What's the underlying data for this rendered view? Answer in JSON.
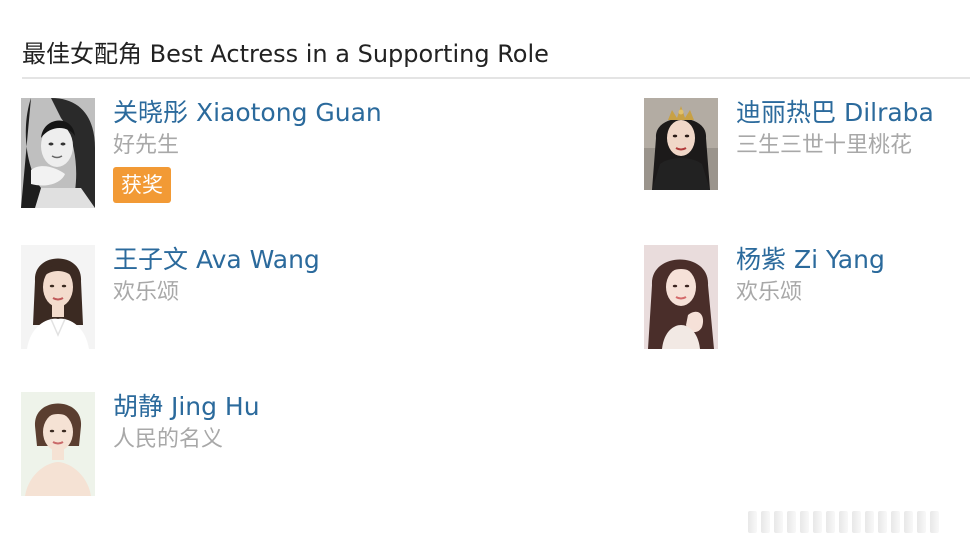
{
  "section": {
    "title": "最佳女配角 Best Actress in a Supporting Role"
  },
  "nominees": [
    {
      "name": "关晓彤 Xiaotong Guan",
      "film": "好先生",
      "badge": "获奖",
      "photo_icon": "portrait-photo-bw"
    },
    {
      "name": "迪丽热巴 Dilraba",
      "film": "三生三世十里桃花",
      "photo_icon": "portrait-photo-crown"
    },
    {
      "name": "王子文 Ava Wang",
      "film": "欢乐颂",
      "photo_icon": "portrait-photo"
    },
    {
      "name": "杨紫 Zi Yang",
      "film": "欢乐颂",
      "photo_icon": "portrait-photo"
    },
    {
      "name": "胡静 Jing Hu",
      "film": "人民的名义",
      "photo_icon": "portrait-photo"
    }
  ],
  "colors": {
    "name_link": "#2b6a9c",
    "film_text": "#a8a8a8",
    "badge_bg": "#f29a35",
    "divider": "#e4e4e4"
  }
}
